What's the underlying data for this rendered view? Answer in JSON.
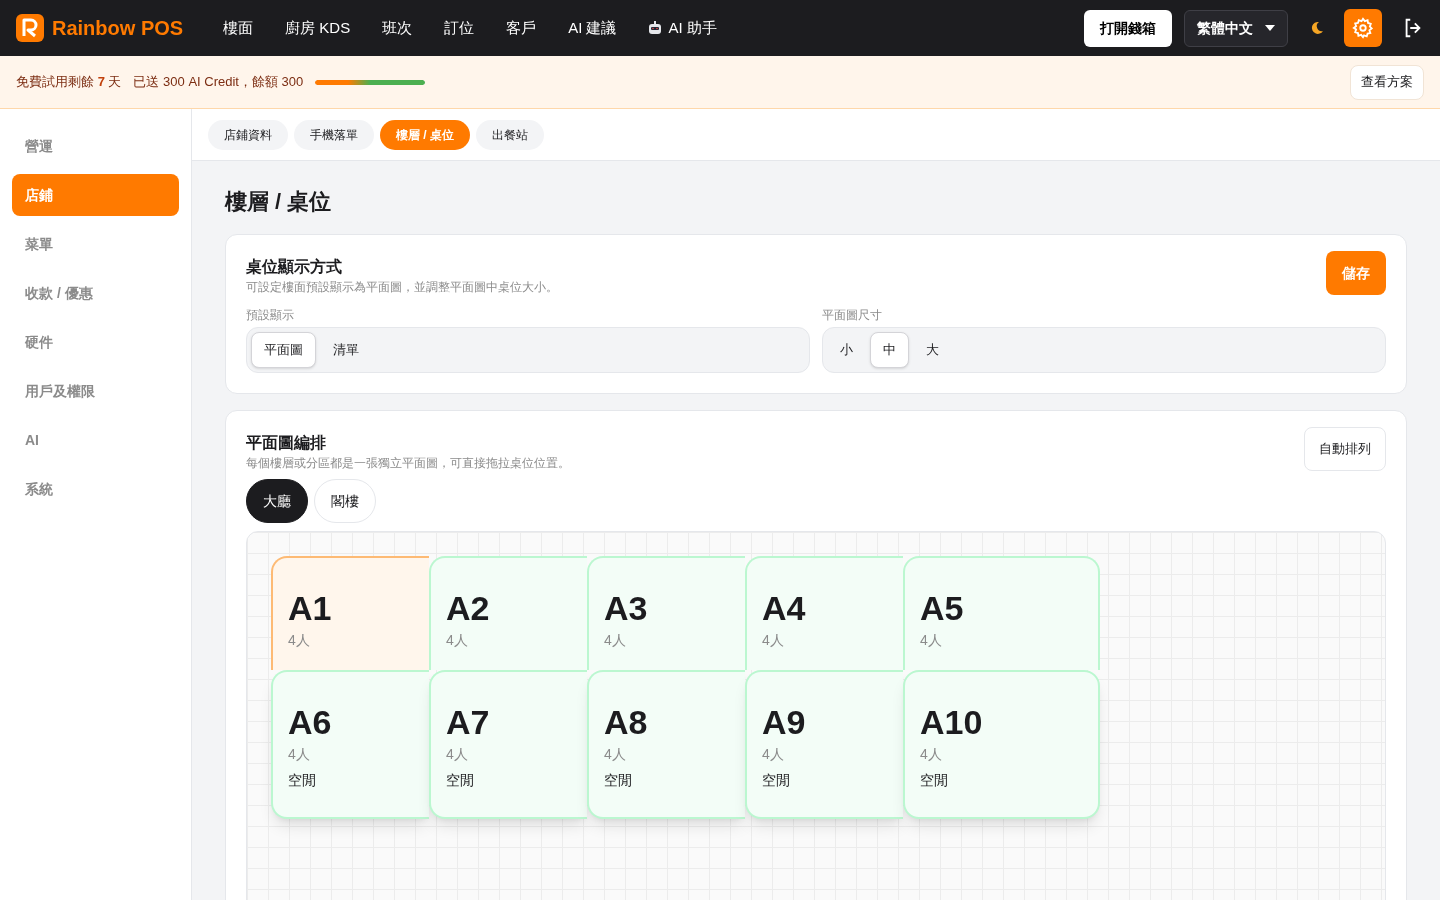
{
  "header": {
    "brand": "Rainbow POS",
    "nav": [
      {
        "label": "樓面",
        "kind": "text"
      },
      {
        "label": "廚房 KDS",
        "kind": "text"
      },
      {
        "label": "班次",
        "kind": "text"
      },
      {
        "label": "訂位",
        "kind": "text"
      },
      {
        "label": "客戶",
        "kind": "text"
      },
      {
        "label": "AI 建議",
        "kind": "text"
      },
      {
        "label": "AI 助手",
        "kind": "robot"
      }
    ],
    "cash_drawer_button": "打開錢箱",
    "language": "繁體中文"
  },
  "trial_bar": {
    "days_text": "免費試用剩餘 **7** 天",
    "credit_text": "已送 300 AI Credit，餘額 300",
    "level": 1,
    "plan_button": "查看方案"
  },
  "sidebar": {
    "items": [
      {
        "label": "營運",
        "selected": false
      },
      {
        "label": "店鋪",
        "selected": true
      },
      {
        "label": "菜單",
        "selected": false
      },
      {
        "label": "收款 / 優惠",
        "selected": false
      },
      {
        "label": "硬件",
        "selected": false
      },
      {
        "label": "用戶及權限",
        "selected": false
      },
      {
        "label": "AI",
        "selected": false
      },
      {
        "label": "系統",
        "selected": false
      }
    ]
  },
  "tabs": [
    {
      "label": "店鋪資料",
      "selected": false
    },
    {
      "label": "手機落單",
      "selected": false
    },
    {
      "label": "樓層 / 桌位",
      "selected": true
    },
    {
      "label": "出餐站",
      "selected": false
    }
  ],
  "page_title": "樓層 / 桌位",
  "display_card": {
    "title": "桌位顯示方式",
    "description": "可設定樓面預設顯示為平面圖，並調整平面圖中桌位大小。",
    "save_button": "儲存",
    "default_view": {
      "label": "預設顯示",
      "options": [
        {
          "label": "平面圖",
          "selected": true
        },
        {
          "label": "清單",
          "selected": false
        }
      ]
    },
    "plan_size": {
      "label": "平面圖尺寸",
      "options": [
        {
          "label": "小",
          "selected": false
        },
        {
          "label": "中",
          "selected": true
        },
        {
          "label": "大",
          "selected": false
        }
      ]
    }
  },
  "layout_card": {
    "title": "平面圖編排",
    "description": "每個樓層或分區都是一張獨立平面圖，可直接拖拉桌位位置。",
    "auto_arrange_button": "自動排列",
    "floors": [
      {
        "label": "大廳",
        "selected": true
      },
      {
        "label": "閣樓",
        "selected": false
      }
    ],
    "tables": [
      {
        "name": "A1",
        "seats": "4人",
        "kind": "occupied"
      },
      {
        "name": "A2",
        "seats": "4人",
        "kind": "free"
      },
      {
        "name": "A3",
        "seats": "4人",
        "kind": "free"
      },
      {
        "name": "A4",
        "seats": "4人",
        "kind": "free"
      },
      {
        "name": "A5",
        "seats": "4人",
        "kind": "free"
      },
      {
        "name": "A6",
        "seats": "4人",
        "status": "空閒",
        "kind": "free"
      },
      {
        "name": "A7",
        "seats": "4人",
        "status": "空閒",
        "kind": "free"
      },
      {
        "name": "A8",
        "seats": "4人",
        "status": "空閒",
        "kind": "free"
      },
      {
        "name": "A9",
        "seats": "4人",
        "status": "空閒",
        "kind": "free"
      },
      {
        "name": "A10",
        "seats": "4人",
        "status": "空閒",
        "kind": "free"
      }
    ]
  }
}
